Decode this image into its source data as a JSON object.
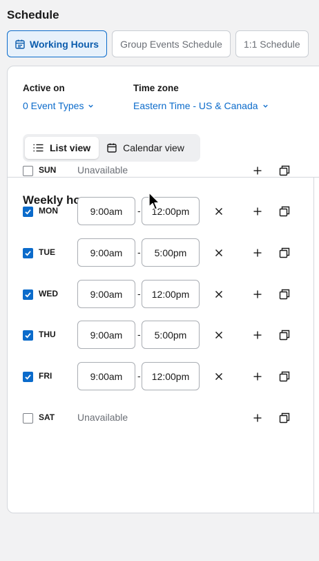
{
  "page": {
    "title": "Schedule",
    "tabs": [
      "Working Hours",
      "Group Events Schedule",
      "1:1 Schedule"
    ]
  },
  "settings": {
    "active_on_label": "Active on",
    "active_on_value": "0 Event Types",
    "timezone_label": "Time zone",
    "timezone_value": "Eastern Time - US & Canada"
  },
  "view_toggle": {
    "list": "List view",
    "calendar": "Calendar view",
    "selected": "List view"
  },
  "weekly": {
    "title": "Weekly hours",
    "unavailable_text": "Unavailable",
    "days": [
      {
        "label": "SUN",
        "checked": false,
        "start": "",
        "end": ""
      },
      {
        "label": "MON",
        "checked": true,
        "start": "9:00am",
        "end": "12:00pm"
      },
      {
        "label": "TUE",
        "checked": true,
        "start": "9:00am",
        "end": "5:00pm"
      },
      {
        "label": "WED",
        "checked": true,
        "start": "9:00am",
        "end": "12:00pm"
      },
      {
        "label": "THU",
        "checked": true,
        "start": "9:00am",
        "end": "5:00pm"
      },
      {
        "label": "FRI",
        "checked": true,
        "start": "9:00am",
        "end": "12:00pm"
      },
      {
        "label": "SAT",
        "checked": false,
        "start": "",
        "end": ""
      }
    ]
  },
  "colors": {
    "accent": "#0b6bcb",
    "tab_active_bg": "#e7f1fb",
    "muted_text": "#6b6f76"
  }
}
